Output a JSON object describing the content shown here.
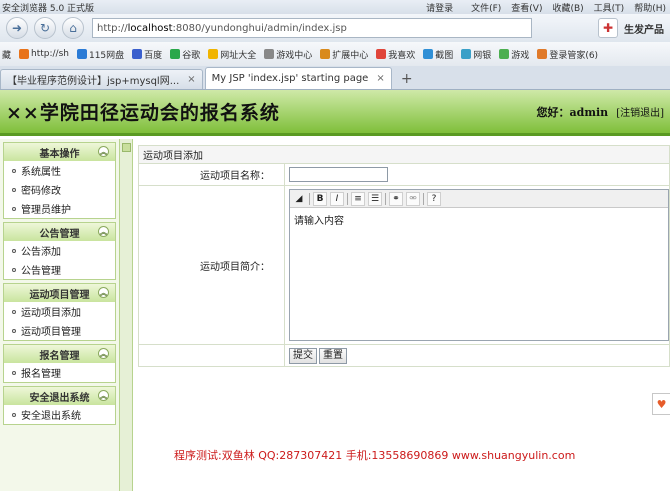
{
  "browser": {
    "title": "安全浏览器 5.0 正式版",
    "login": "请登录",
    "menu": [
      "文件(F)",
      "查看(V)",
      "收藏(B)",
      "工具(T)",
      "帮助(H)"
    ],
    "url_prefix": "http://",
    "url_host": "localhost",
    "url_rest": ":8080/yundonghui/admin/index.jsp",
    "product": "生发产品",
    "bookmarks": [
      "藏",
      "http://sh",
      "115网盘",
      "百度",
      "谷歌",
      "网址大全",
      "游戏中心",
      "扩展中心",
      "我喜欢",
      "截图",
      "网银",
      "游戏",
      "登录管家(6)"
    ],
    "tabs": [
      {
        "label": "【毕业程序范例设计】jsp+mysql网...",
        "active": false
      },
      {
        "label": "My JSP 'index.jsp' starting page",
        "active": true
      }
    ]
  },
  "header": {
    "system_title": "××学院田径运动会的报名系统",
    "greeting": "您好：admin",
    "logout": "[注销退出]"
  },
  "sidebar": {
    "groups": [
      {
        "title": "基本操作",
        "items": [
          "系统属性",
          "密码修改",
          "管理员维护"
        ]
      },
      {
        "title": "公告管理",
        "items": [
          "公告添加",
          "公告管理"
        ]
      },
      {
        "title": "运动项目管理",
        "items": [
          "运动项目添加",
          "运动项目管理"
        ]
      },
      {
        "title": "报名管理",
        "items": [
          "报名管理"
        ]
      },
      {
        "title": "安全退出系统",
        "items": [
          "安全退出系统"
        ]
      }
    ]
  },
  "form": {
    "heading": "运动项目添加",
    "name_label": "运动项目名称：",
    "name_value": "",
    "intro_label": "运动项目简介：",
    "editor_placeholder": "请输入内容",
    "submit_label": "提交",
    "reset_label": "重置"
  },
  "footer": {
    "text": "程序测试:双鱼林 QQ:287307421 手机:13558690869 www.shuangyulin.com"
  }
}
